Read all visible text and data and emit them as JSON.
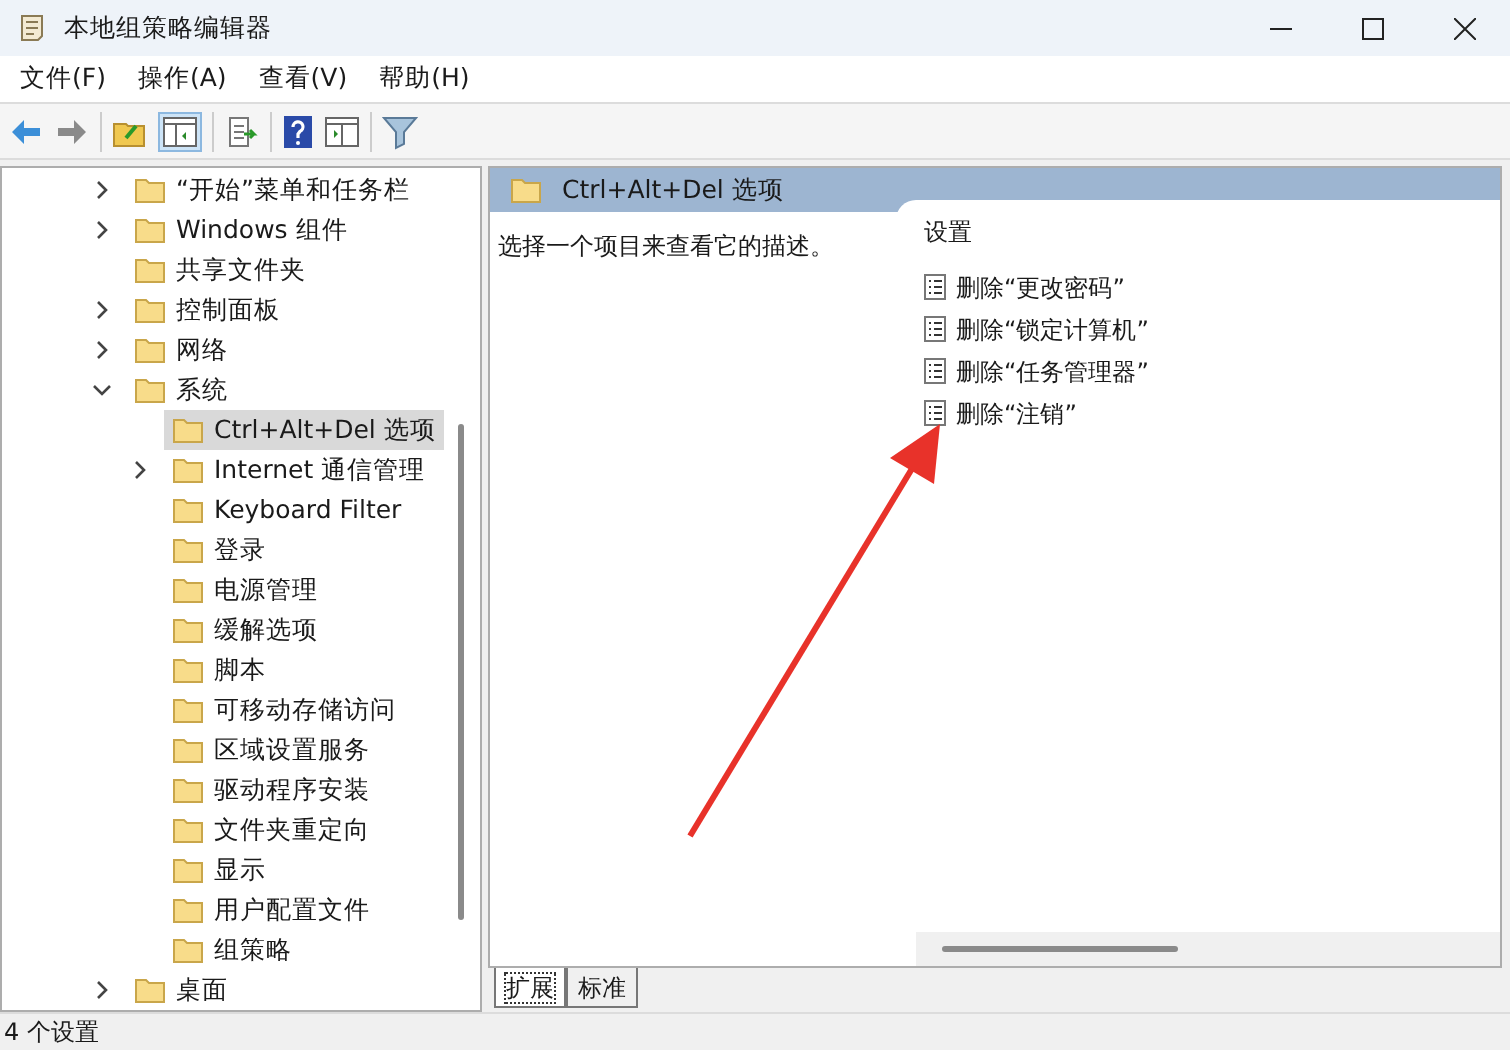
{
  "window": {
    "title": "本地组策略编辑器"
  },
  "menu": [
    "文件(F)",
    "操作(A)",
    "查看(V)",
    "帮助(H)"
  ],
  "tree": [
    {
      "label": "“开始”菜单和任务栏",
      "kind": "branch",
      "expanded": false,
      "selected": false
    },
    {
      "label": "Windows 组件",
      "kind": "branch",
      "expanded": false,
      "selected": false
    },
    {
      "label": "共享文件夹",
      "kind": "leaf",
      "selected": false
    },
    {
      "label": "控制面板",
      "kind": "branch",
      "expanded": false,
      "selected": false
    },
    {
      "label": "网络",
      "kind": "branch",
      "expanded": false,
      "selected": false
    },
    {
      "label": "系统",
      "kind": "branch",
      "expanded": true,
      "selected": false,
      "children": [
        {
          "label": "Ctrl+Alt+Del 选项",
          "kind": "leaf",
          "selected": true
        },
        {
          "label": "Internet 通信管理",
          "kind": "branch",
          "expanded": false,
          "selected": false
        },
        {
          "label": "Keyboard Filter",
          "kind": "leaf",
          "selected": false
        },
        {
          "label": "登录",
          "kind": "leaf",
          "selected": false
        },
        {
          "label": "电源管理",
          "kind": "leaf",
          "selected": false
        },
        {
          "label": "缓解选项",
          "kind": "leaf",
          "selected": false
        },
        {
          "label": "脚本",
          "kind": "leaf",
          "selected": false
        },
        {
          "label": "可移动存储访问",
          "kind": "leaf",
          "selected": false
        },
        {
          "label": "区域设置服务",
          "kind": "leaf",
          "selected": false
        },
        {
          "label": "驱动程序安装",
          "kind": "leaf",
          "selected": false
        },
        {
          "label": "文件夹重定向",
          "kind": "leaf",
          "selected": false
        },
        {
          "label": "显示",
          "kind": "leaf",
          "selected": false
        },
        {
          "label": "用户配置文件",
          "kind": "leaf",
          "selected": false
        },
        {
          "label": "组策略",
          "kind": "leaf",
          "selected": false
        }
      ]
    },
    {
      "label": "桌面",
      "kind": "branch",
      "expanded": false,
      "selected": false
    }
  ],
  "details": {
    "title": "Ctrl+Alt+Del 选项",
    "description": "选择一个项目来查看它的描述。",
    "column_heading": "设置",
    "settings": [
      "删除“更改密码”",
      "删除“锁定计算机”",
      "删除“任务管理器”",
      "删除“注销”"
    ]
  },
  "tabs": [
    {
      "label": "扩展",
      "selected": true
    },
    {
      "label": "标准",
      "selected": false
    }
  ],
  "status_bar": "4 个设置"
}
